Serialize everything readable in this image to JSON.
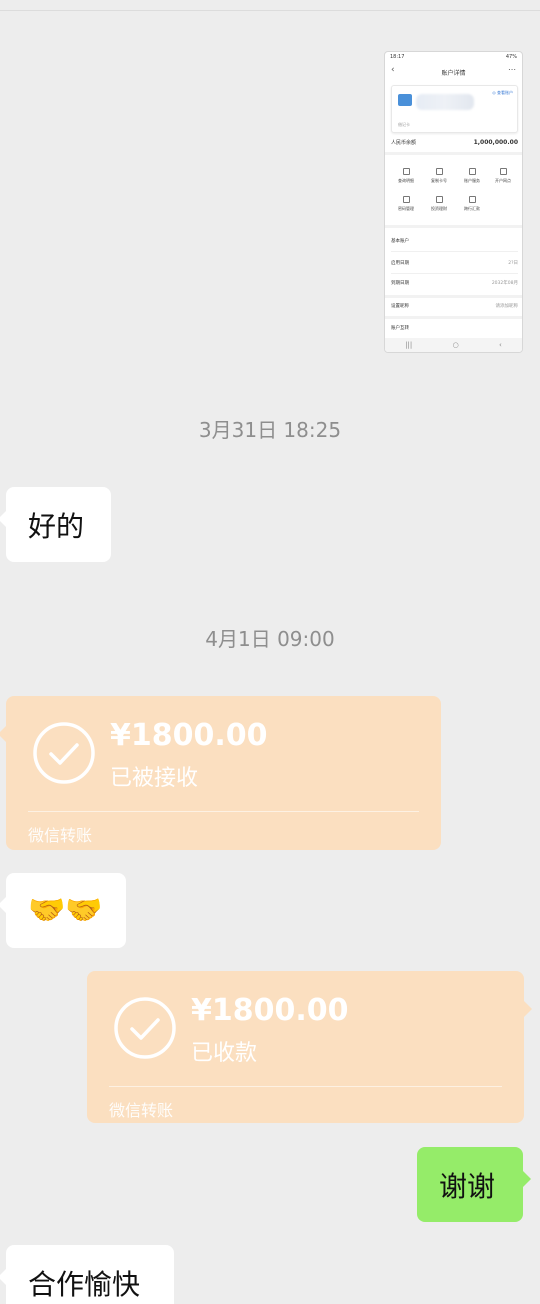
{
  "timestamps": [
    "3月31日 18:25",
    "4月1日 09:00"
  ],
  "messages": {
    "ok": "好的",
    "handshake": "🤝🤝",
    "thanks": "谢谢",
    "pleasure": "合作愉快"
  },
  "transfer_received": {
    "amount": "¥1800.00",
    "status": "已被接收",
    "footer": "微信转账"
  },
  "transfer_collected": {
    "amount": "¥1800.00",
    "status": "已收款",
    "footer": "微信转账"
  },
  "thumbnail": {
    "status_left": "18:17",
    "status_right": "47%",
    "title": "账户详情",
    "card_tag": "◎ 查看账户",
    "card_label": "借记卡",
    "balance_label": "人民币余额",
    "balance_value": "1,000,000.00",
    "grid": [
      "查询明细",
      "复制卡号",
      "账户服务",
      "开户网点",
      "密码管理",
      "投资理财",
      "跨行汇款"
    ],
    "rows": [
      {
        "label": "基本账户",
        "value": ""
      },
      {
        "label": "启用日期",
        "value": "2?日"
      },
      {
        "label": "到期日期",
        "value": "2032年08月"
      },
      {
        "label": "设置昵称",
        "value": "请添加昵称"
      },
      {
        "label": "账户互转",
        "value": ""
      }
    ]
  },
  "colors": {
    "background": "#ededed",
    "white_bubble": "#ffffff",
    "green_bubble": "#95ec69",
    "transfer_bubble": "#fbdfc0"
  }
}
